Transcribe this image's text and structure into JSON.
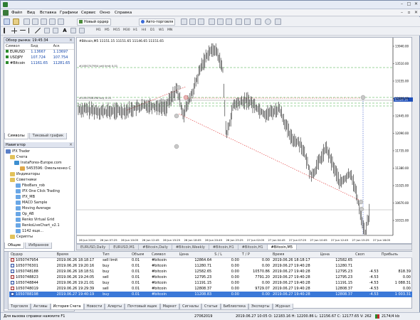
{
  "app": {
    "title_icon": "metatrader-icon"
  },
  "menu": [
    "Файл",
    "Вид",
    "Вставка",
    "Графики",
    "Сервис",
    "Окно",
    "Справка"
  ],
  "toolbar": {
    "new_order": "Новый ордер",
    "auto_trading": "Авто-торговля",
    "timeframes": [
      "M1",
      "M5",
      "M15",
      "M30",
      "H1",
      "H4",
      "D1",
      "W1",
      "MN"
    ]
  },
  "market_watch": {
    "title": "Обзор рынка: 19:45:34",
    "columns": [
      "Символ",
      "Бид",
      "Аск"
    ],
    "rows": [
      {
        "symbol": "EURUSD",
        "bid": "1.13667",
        "ask": "1.13697"
      },
      {
        "symbol": "USDJPY",
        "bid": "107.724",
        "ask": "107.754"
      },
      {
        "symbol": "#Bitcoin",
        "bid": "11161.65",
        "ask": "11281.65"
      }
    ],
    "tabs": [
      "Символы",
      "Тиковый график"
    ]
  },
  "navigator": {
    "title": "Навигатор",
    "items": [
      "IFX Trader",
      "Счета",
      "InstaForex-Europe.com",
      "5453596: Омельченко С",
      "Индикаторы",
      "Советники",
      "FiboBars_rob",
      "IFX One Click Trading",
      "IFX_MB",
      "MACD Sample",
      "Moving Average",
      "Op_AB",
      "Renko Virtual Grid",
      "RenkoLiveChart_v2.1",
      "1142 еще...",
      "Скрипты"
    ],
    "tabs": [
      "Общие",
      "Избранное"
    ]
  },
  "chart": {
    "header": "#Bitcoin,M5  11151.15 11151.65 11146.65 11151.65",
    "sell_limit_label": "#1050747954 sell limit 0.01",
    "buy_label": "#1050788198 buy 0.01",
    "price_axis": [
      "13940.00",
      "13510.00",
      "13155.00",
      "12800.00",
      "12445.00",
      "12090.00",
      "11735.00",
      "11380.00",
      "11025.00",
      "10670.00",
      "10315.00",
      "12128.16"
    ],
    "time_axis": [
      "26 Jun 2019",
      "26 Jun 07:25",
      "26 Jun 10:05",
      "26 Jun 12:45",
      "26 Jun 15:25",
      "26 Jun 18:05",
      "26 Jun 20:45",
      "26 Jun 23:25",
      "27 Jun 02:05",
      "27 Jun 04:45",
      "27 Jun 07:25",
      "27 Jun 10:05",
      "27 Jun 12:45",
      "27 Jun 15:25",
      "27 Jun 18:05"
    ],
    "tabs": [
      "EURUSD,Daily",
      "EURUSD,M1",
      "#Bitcoin,Daily",
      "#Bitcoin,Weekly",
      "#Bitcoin,H1",
      "#Bitcoin,H1",
      "#Bitcoin,M5"
    ]
  },
  "terminal": {
    "columns": [
      "Ордер",
      "Время",
      "Тип",
      "Объем",
      "Символ",
      "Цена",
      "S / L",
      "T / P",
      "Время",
      "Цена",
      "Своп",
      "Прибыль"
    ],
    "rows": [
      [
        "1050747954",
        "2019.06.26 18:18:17",
        "sell limit",
        "0.01",
        "#bitcoin",
        "12864.64",
        "0.00",
        "0.00",
        "2019.06.26 18:18:17",
        "12582.65",
        "",
        ""
      ],
      [
        "1050776301",
        "2019.06.26 19:20:16",
        "buy",
        "0.01",
        "#bitcoin",
        "11280.71",
        "0.00",
        "0.00",
        "2019.06.27 19:40:28",
        "11280.71",
        "",
        ""
      ],
      [
        "1050748188",
        "2019.06.26 18:18:51",
        "buy",
        "0.01",
        "#bitcoin",
        "12582.65",
        "0.00",
        "10570.86",
        "2019.06.27 19:40:28",
        "12795.23",
        "-4.53",
        "818.39"
      ],
      [
        "1050748823",
        "2019.06.26 19:24:05",
        "sell",
        "0.01",
        "#bitcoin",
        "12795.23",
        "0.00",
        "7791.20",
        "2019.06.27 19:40:28",
        "12795.23",
        "-4.53",
        "0.00"
      ],
      [
        "1050748844",
        "2019.06.26 19:21:01",
        "buy",
        "0.01",
        "#bitcoin",
        "11191.15",
        "0.00",
        "0.00",
        "2019.06.27 19:40:28",
        "11191.15",
        "-4.53",
        "1 088.31"
      ],
      [
        "1050748019",
        "2019.06.26 19:29:39",
        "sell",
        "0.01",
        "#bitcoin",
        "12808.37",
        "0.00",
        "9729.07",
        "2019.06.27 19:40:28",
        "12808.37",
        "-4.53",
        "0.00"
      ],
      [
        "1050788198",
        "2019.06.27 19:40:19",
        "buy",
        "0.01",
        "#bitcoin",
        "11208.83",
        "0.00",
        "0.00",
        "2019.06.27 19:40:28",
        "12808.37",
        "-4.53",
        "1 003.31"
      ]
    ],
    "tabs": [
      "Торговля",
      "Активы",
      "История Счета",
      "Новости",
      "Алерты",
      "Почтовый ящик",
      "Маркет",
      "Сигналы",
      "Статьи",
      "Библиотека",
      "Эксперты",
      "Журнал"
    ],
    "active_tab": "История Счета",
    "side_label": "Терминал"
  },
  "status": {
    "help": "Для вызова справки нажмите F1",
    "profile": "27062019",
    "ohlc": "2019.06.27 10:05    O: 12183.16    H: 12200.86    L: 12156.67    C: 12177.65    V: 262",
    "traffic": "2174/4 kb"
  }
}
